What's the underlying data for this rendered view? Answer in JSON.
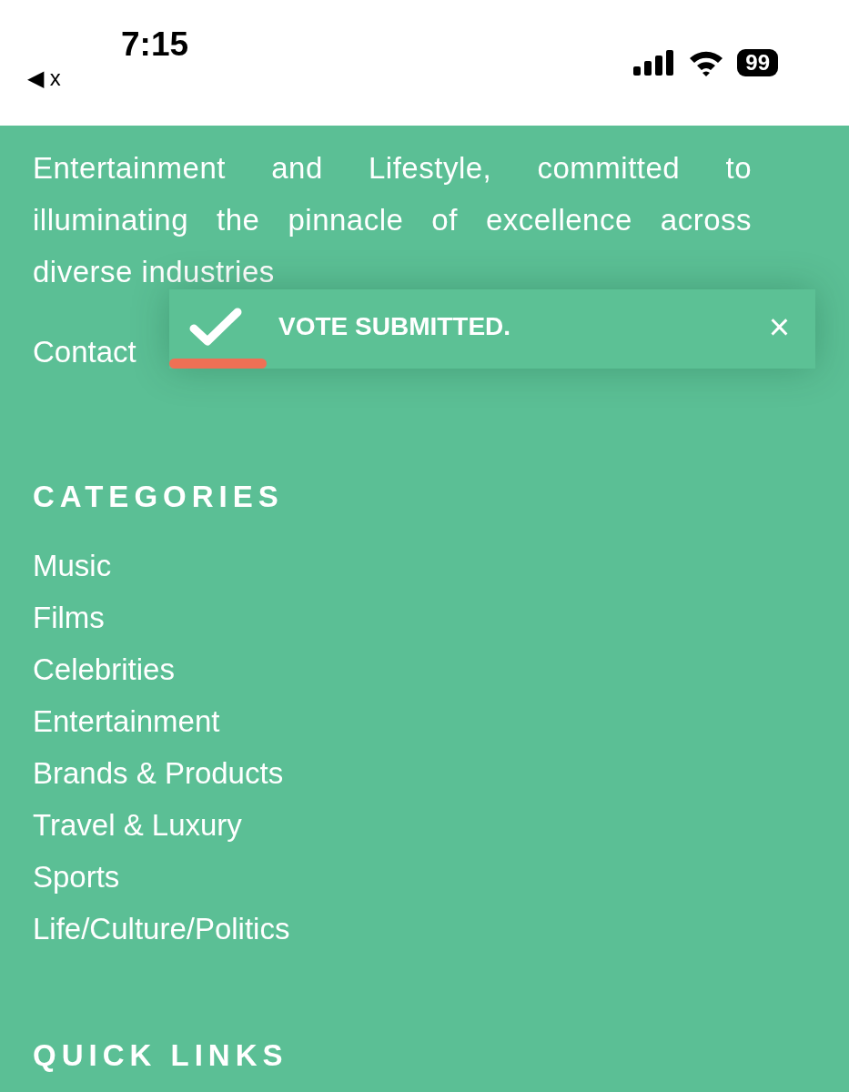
{
  "status_bar": {
    "time": "7:15",
    "back_label": "◀ x",
    "battery": "99"
  },
  "about": {
    "text": "Entertainment and Lifestyle, committed to illuminating the pinnacle of excellence across diverse industries",
    "contact": "Contact"
  },
  "toast": {
    "message": "VOTE SUBMITTED.",
    "close": "×",
    "level": 0.15
  },
  "categories": {
    "heading": "CATEGORIES",
    "items": [
      "Music",
      "Films",
      "Celebrities",
      "Entertainment",
      "Brands & Products",
      "Travel & Luxury",
      "Sports",
      "Life/Culture/Politics"
    ]
  },
  "quick_links": {
    "heading": "QUICK LINKS"
  }
}
